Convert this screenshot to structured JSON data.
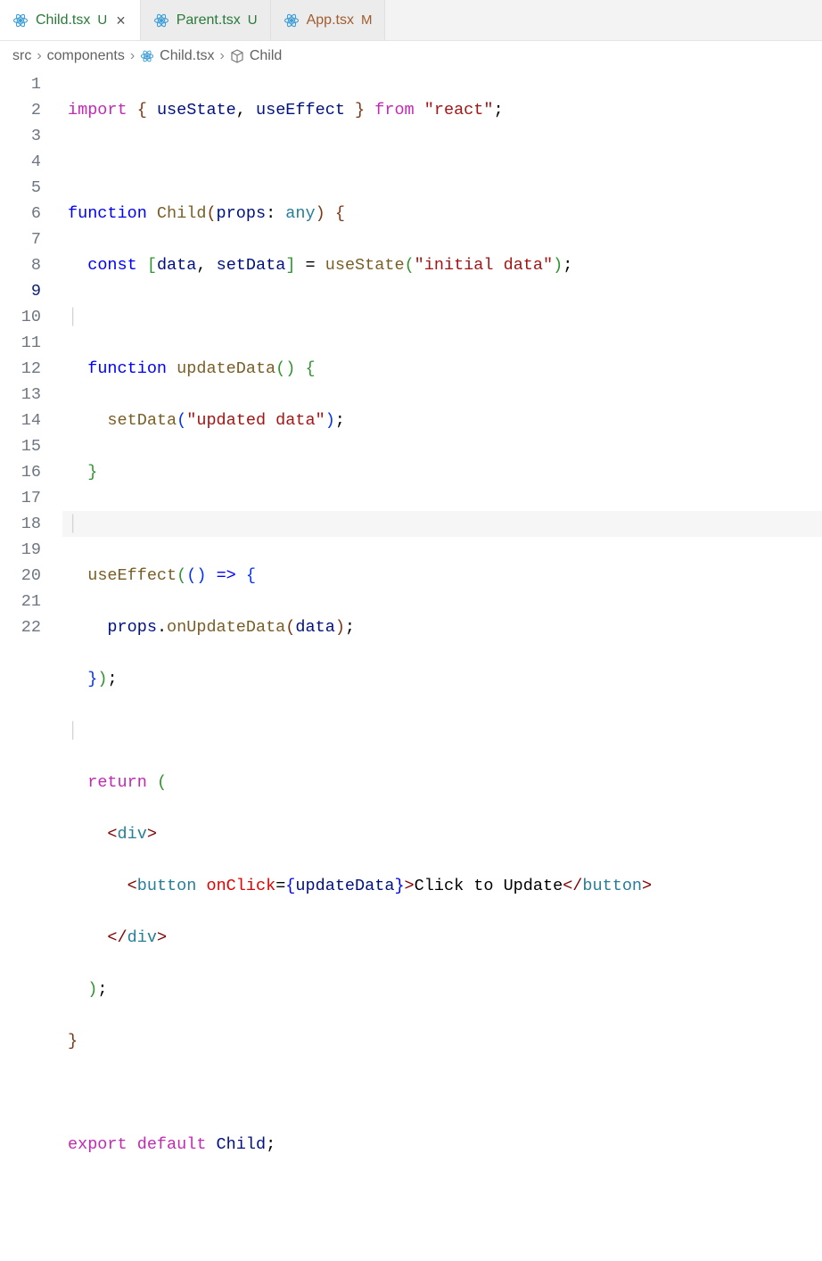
{
  "tabs": [
    {
      "name": "Child.tsx",
      "status": "U",
      "active": true,
      "statusClass": ""
    },
    {
      "name": "Parent.tsx",
      "status": "U",
      "active": false,
      "statusClass": ""
    },
    {
      "name": "App.tsx",
      "status": "M",
      "active": false,
      "statusClass": "modified"
    }
  ],
  "breadcrumb": {
    "p0": "src",
    "p1": "components",
    "p2": "Child.tsx",
    "p3": "Child"
  },
  "code": {
    "lines": 22,
    "cursorLine": 9,
    "l1": {
      "import": "import",
      "br1": "{ ",
      "useState": "useState",
      "comma": ", ",
      "useEffect": "useEffect",
      "br2": " }",
      "from": " from ",
      "str": "\"react\"",
      "semi": ";"
    },
    "l3": {
      "function": "function ",
      "name": "Child",
      "open": "(",
      "param": "props",
      "colon": ": ",
      "type": "any",
      "close": ") ",
      "brace": "{"
    },
    "l4": {
      "const": "const ",
      "br1": "[",
      "data": "data",
      "comma": ", ",
      "setData": "setData",
      "br2": "]",
      "eq": " = ",
      "useState": "useState",
      "open": "(",
      "str": "\"initial data\"",
      "close": ")",
      "semi": ";"
    },
    "l6": {
      "function": "function ",
      "name": "updateData",
      "open": "()",
      "brace": " {"
    },
    "l7": {
      "call": "setData",
      "open": "(",
      "str": "\"updated data\"",
      "close": ")",
      "semi": ";"
    },
    "l8": {
      "brace": "}"
    },
    "l10": {
      "call": "useEffect",
      "open": "(",
      "paren": "()",
      "arrow": " => ",
      "brace": "{"
    },
    "l11": {
      "props": "props",
      "dot": ".",
      "method": "onUpdateData",
      "open": "(",
      "arg": "data",
      "close": ")",
      "semi": ";"
    },
    "l12": {
      "brace": "}",
      "close": ")",
      "semi": ";"
    },
    "l14": {
      "return": "return ",
      "open": "("
    },
    "l15": {
      "lt": "<",
      "tag": "div",
      "gt": ">"
    },
    "l16": {
      "lt": "<",
      "tag": "button",
      "sp": " ",
      "attr": "onClick",
      "eq": "=",
      "br1": "{",
      "val": "updateData",
      "br2": "}",
      "gt": ">",
      "text": "Click to Update",
      "lt2": "</",
      "tag2": "button",
      "gt2": ">"
    },
    "l17": {
      "lt": "</",
      "tag": "div",
      "gt": ">"
    },
    "l18": {
      "close": ")",
      "semi": ";"
    },
    "l19": {
      "brace": "}"
    },
    "l21": {
      "export": "export ",
      "default": "default ",
      "name": "Child",
      "semi": ";"
    }
  }
}
